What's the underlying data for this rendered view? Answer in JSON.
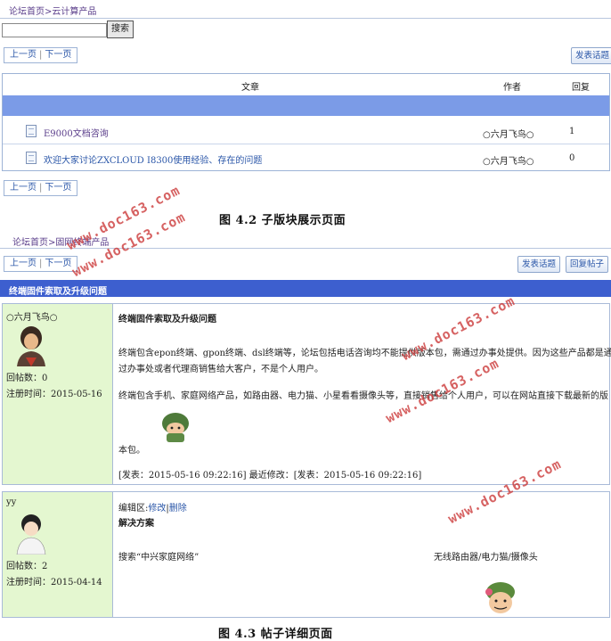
{
  "section1": {
    "breadcrumb": "论坛首页>云计算产品",
    "search_placeholder": "",
    "search_button": "搜索",
    "prev_label": "上一页",
    "separator": "|",
    "next_label": "下一页",
    "post_topic_button": "发表话题",
    "table": {
      "headers": {
        "article": "文章",
        "author": "作者",
        "replies": "回复"
      },
      "rows": [
        {
          "title": "E9000文档咨询",
          "author": "○六月飞鸟○",
          "replies": "1"
        },
        {
          "title": "欢迎大家讨论ZXCLOUD I8300使用经验、存在的问题",
          "author": "○六月飞鸟○",
          "replies": "0"
        }
      ]
    },
    "caption": "图 4.2 子版块展示页面"
  },
  "section2": {
    "breadcrumb": "论坛首页>固网终端产品",
    "prev_label": "上一页",
    "separator": "|",
    "next_label": "下一页",
    "post_topic_button": "发表话题",
    "reply_button": "回复帖子",
    "thread_title": "终端固件索取及升级问题",
    "posts": [
      {
        "username": "○六月飞鸟○",
        "post_count": "回帖数：0",
        "register": "注册时间：2015-05-16",
        "title": "终端固件索取及升级问题",
        "para1_line1": "终端包含epon终端、gpon终端、dsl终端等，论坛包括电话咨询均不能提供版本包，需通过办事处提供。因为这些产品都是通",
        "para1_line2": "过办事处或者代理商销售给大客户，不是个人用户。",
        "para2_line1": "终端包含手机、家庭网络产品，如路由器、电力猫、小星看看摄像头等，直接销售给个人用户，可以在网站直接下载最新的版",
        "para2_line2": "本包。",
        "footer": "[发表：2015-05-16 09:22:16] 最近修改：[发表：2015-05-16 09:22:16]"
      },
      {
        "username": "yy",
        "post_count": "回帖数：2",
        "register": "注册时间：2015-04-14",
        "edit_prefix": "编辑区:",
        "edit_link": "修改",
        "delete_link": "删除",
        "title": "解决方案",
        "search_text": "搜索“中兴家庭网络”",
        "right_text": "无线路由器/电力猫/摄像头"
      }
    ],
    "caption": "图 4.3 帖子详细页面"
  },
  "watermarks": [
    "www.doc163.com",
    "www.doc163.com",
    "www.doc163.com",
    "www.doc163.com",
    "www.doc163.com"
  ],
  "colors": {
    "band": "#7b9be7",
    "title_bar": "#3d5fcf",
    "author_panel": "#e4f7d0",
    "watermark": "#cc3b3b"
  }
}
